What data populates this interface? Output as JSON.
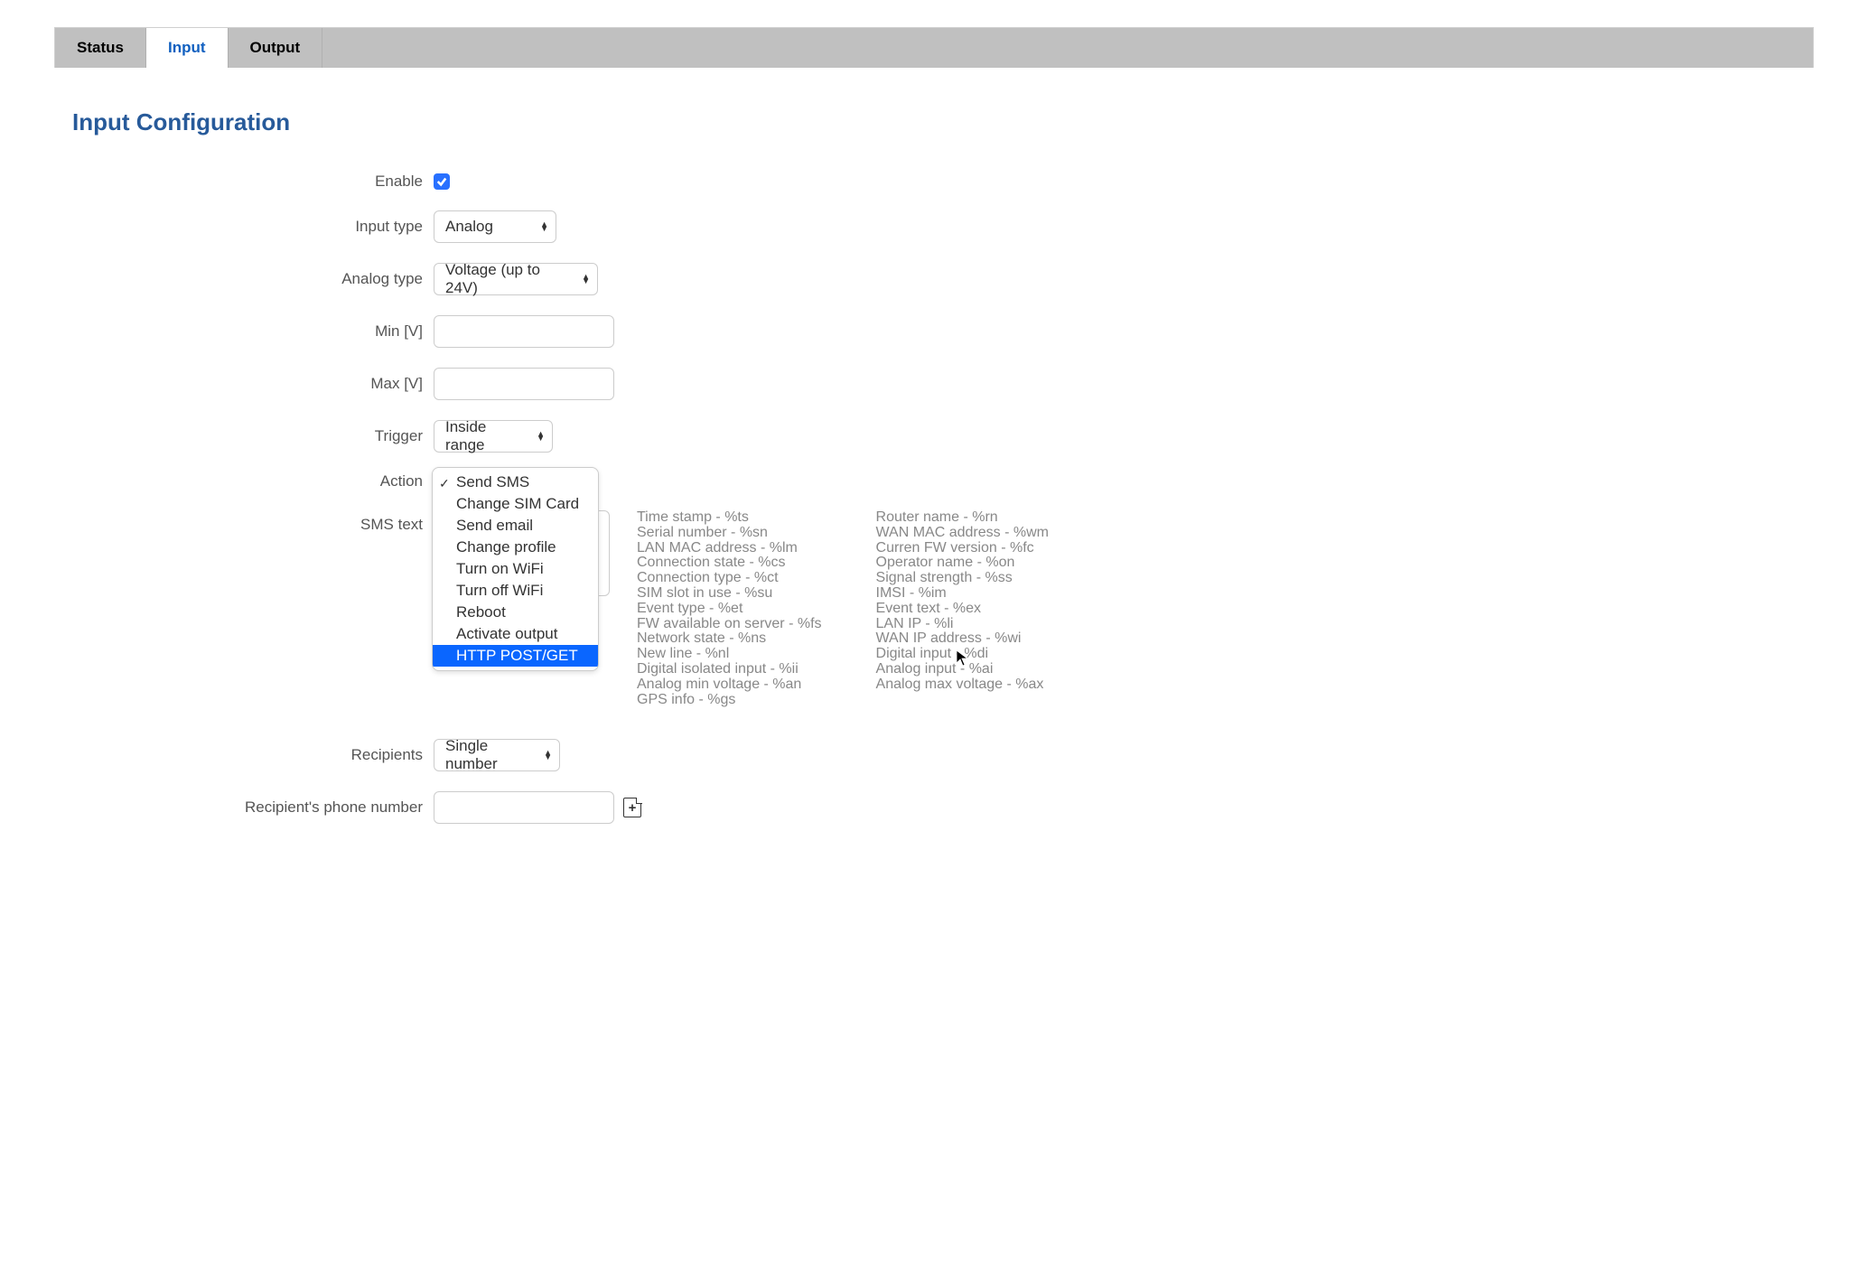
{
  "tabs": {
    "status": "Status",
    "input": "Input",
    "output": "Output"
  },
  "page_title": "Input Configuration",
  "form": {
    "enable": {
      "label": "Enable",
      "checked": true
    },
    "input_type": {
      "label": "Input type",
      "value": "Analog"
    },
    "analog_type": {
      "label": "Analog type",
      "value": "Voltage (up to 24V)"
    },
    "min": {
      "label": "Min [V]",
      "value": ""
    },
    "max": {
      "label": "Max [V]",
      "value": ""
    },
    "trigger": {
      "label": "Trigger",
      "value": "Inside range"
    },
    "action": {
      "label": "Action",
      "selected": "Send SMS",
      "options": [
        "Send SMS",
        "Change SIM Card",
        "Send email",
        "Change profile",
        "Turn on WiFi",
        "Turn off WiFi",
        "Reboot",
        "Activate output",
        "HTTP POST/GET"
      ],
      "highlighted": "HTTP POST/GET"
    },
    "sms_text": {
      "label": "SMS text",
      "value": ""
    },
    "recipients": {
      "label": "Recipients",
      "value": "Single number"
    },
    "phone_number": {
      "label": "Recipient's phone number",
      "value": ""
    }
  },
  "hints": {
    "col1": [
      "Time stamp - %ts",
      "Serial number - %sn",
      "LAN MAC address - %lm",
      "Connection state - %cs",
      "Connection type - %ct",
      "SIM slot in use - %su",
      "Event type - %et",
      "FW available on server - %fs",
      "Network state - %ns",
      "New line - %nl",
      "Digital isolated input - %ii",
      "Analog min voltage - %an",
      "GPS info - %gs"
    ],
    "col2": [
      "Router name - %rn",
      "WAN MAC address - %wm",
      "Curren FW version - %fc",
      "Operator name - %on",
      "Signal strength - %ss",
      "IMSI - %im",
      "Event text - %ex",
      "LAN IP - %li",
      "WAN IP address - %wi",
      "Digital input - %di",
      "Analog input - %ai",
      "Analog max voltage - %ax"
    ]
  }
}
